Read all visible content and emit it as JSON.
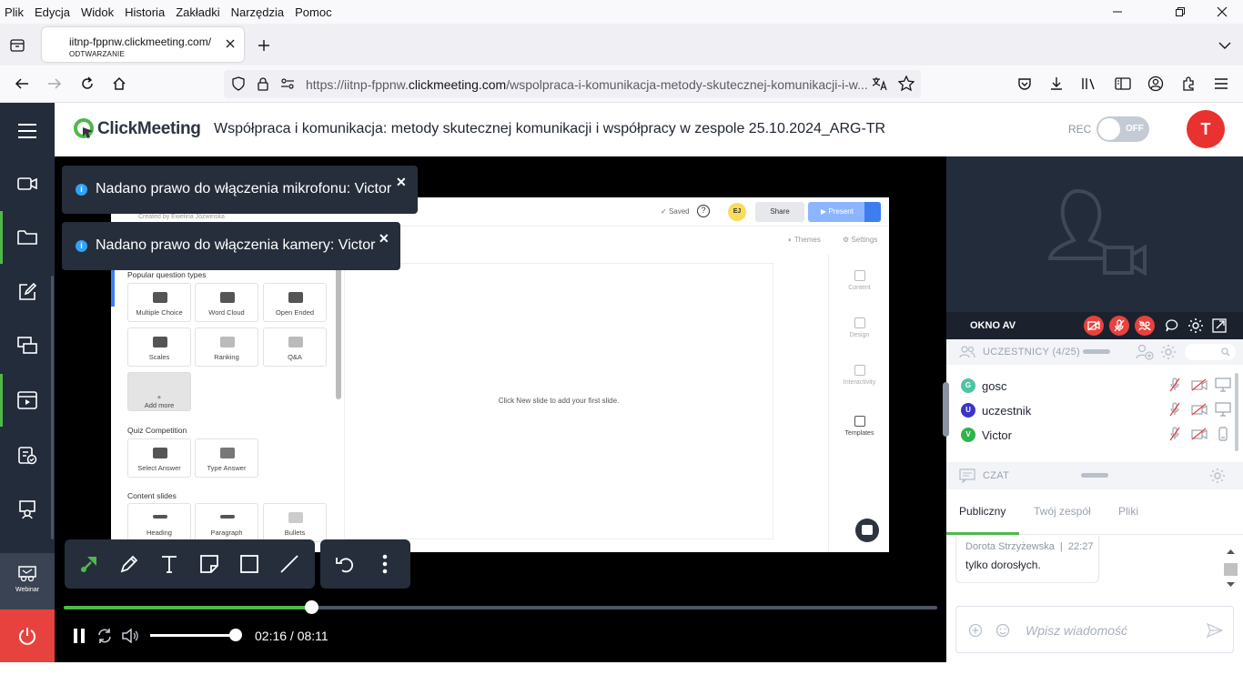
{
  "browser": {
    "menu": [
      "Plik",
      "Edycja",
      "Widok",
      "Historia",
      "Zakładki",
      "Narzędzia",
      "Pomoc"
    ],
    "tab": {
      "title": "iitnp-fppnw.clickmeeting.com/",
      "status": "ODTWARZANIE"
    },
    "url": {
      "prefix": "https://iitnp-fppnw.",
      "host": "clickmeeting.com",
      "path": "/wspolpraca-i-komunikacja-metody-skutecznej-komunikacji-i-w..."
    }
  },
  "header": {
    "logo": "ClickMeeting",
    "title": "Współpraca i komunikacja: metody skutecznej komunikacji i współpracy w zespole 25.10.2024_ARG-TR",
    "rec_label": "REC",
    "rec_toggle": "OFF",
    "avatar_letter": "T"
  },
  "sidebar": {
    "webinar_label": "Webinar"
  },
  "toasts": [
    "Nadano prawo do włączenia mikrofonu: Victor",
    "Nadano prawo do włączenia kamery: Victor"
  ],
  "slide": {
    "created_by": "Created by Ewelina Józwinska",
    "saved": "Saved",
    "avatar": "EJ",
    "share": "Share",
    "present": "Present",
    "themes": "Themes",
    "settings": "Settings",
    "section_popular": "Popular question types",
    "popular": [
      "Multiple Choice",
      "Word Cloud",
      "Open Ended",
      "Scales",
      "Ranking",
      "Q&A"
    ],
    "add_more": "Add more",
    "section_quiz": "Quiz Competition",
    "quiz": [
      "Select Answer",
      "Type Answer"
    ],
    "section_content": "Content slides",
    "content": [
      "Heading",
      "Paragraph",
      "Bullets"
    ],
    "canvas_hint": "Click New slide to add your first slide.",
    "right_rail": [
      "Content",
      "Design",
      "Interactivity",
      "Templates"
    ]
  },
  "player": {
    "progress": 0.283,
    "volume": 1.0,
    "time_current": "02:16",
    "time_total": "08:11"
  },
  "av": {
    "label": "OKNO AV"
  },
  "participants": {
    "label": "UCZESTNICY (4/25)",
    "rows": [
      {
        "initial": "G",
        "name": "gosc",
        "color": "#4ec3a5"
      },
      {
        "initial": "U",
        "name": "uczestnik",
        "color": "#3b34c8"
      },
      {
        "initial": "V",
        "name": "Victor",
        "color": "#2fb34a"
      }
    ]
  },
  "chat": {
    "label": "CZAT",
    "tabs": [
      "Publiczny",
      "Twój zespół",
      "Pliki"
    ],
    "message": {
      "author": "Dorota Strzyżewska",
      "time": "22:27",
      "text": "tylko dorosłych."
    },
    "placeholder": "Wpisz wiadomość"
  },
  "colors": {
    "accent": "#4fb948",
    "danger": "#e8423e",
    "dark": "#232c3b"
  }
}
